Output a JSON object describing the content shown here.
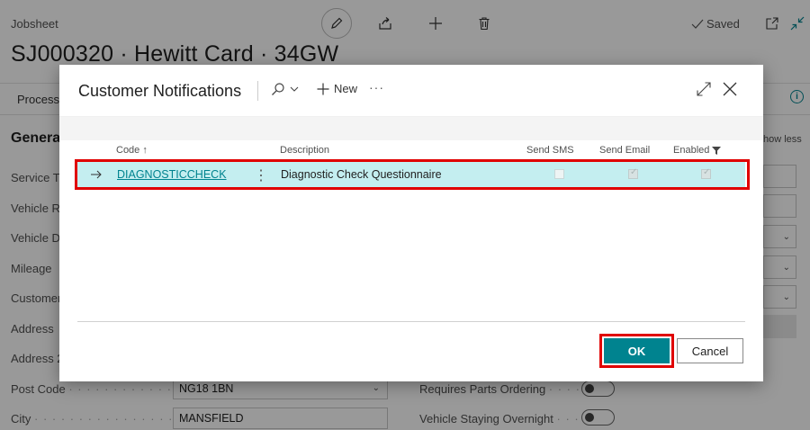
{
  "background": {
    "breadcrumb": "Jobsheet",
    "title": "SJ000320 · Hewitt Card · 34GW",
    "saved": "Saved",
    "action_process": "Process",
    "section_general": "Genera",
    "show_less": "how less",
    "labels": [
      "Service Ty",
      "Vehicle Re",
      "Vehicle De",
      "Mileage",
      "Customer",
      "Address",
      "Address 2"
    ],
    "post_code_label": "Post Code",
    "post_code_value": "NG18 1BN",
    "city_label": "City",
    "city_value": "MANSFIELD",
    "requires_parts_label": "Requires Parts Ordering",
    "staying_overnight_label": "Vehicle Staying Overnight"
  },
  "dialog": {
    "title": "Customer Notifications",
    "new_label": "New",
    "columns": {
      "code": "Code",
      "code_sort": "↑",
      "description": "Description",
      "send_sms": "Send SMS",
      "send_email": "Send Email",
      "enabled": "Enabled"
    },
    "rows": [
      {
        "code": "DIAGNOSTICCHECK",
        "description": "Diagnostic Check Questionnaire",
        "send_sms": false,
        "send_email": true,
        "enabled": true
      }
    ],
    "ok_label": "OK",
    "cancel_label": "Cancel"
  },
  "colors": {
    "accent": "#00838f",
    "row_selected": "#c4eef0",
    "highlight": "#e00000"
  }
}
